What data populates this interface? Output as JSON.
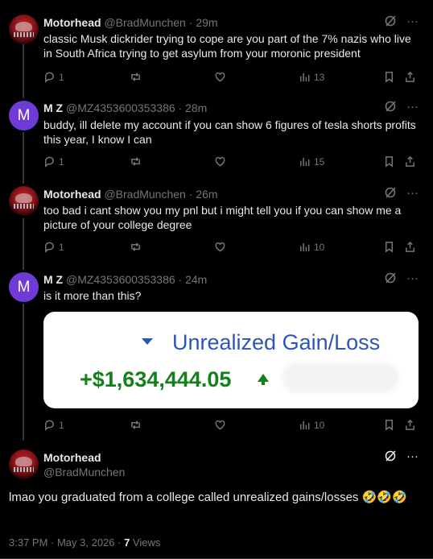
{
  "tweets": [
    {
      "name": "Motorhead",
      "handle": "@BradMunchen",
      "time": "29m",
      "text": "classic Musk dickrider trying to cope are you part of the 7% nazis who live in South Africa trying to get asylum from your moronic president",
      "replies": "1",
      "retweets": "",
      "likes": "",
      "views": "13"
    },
    {
      "name": "M Z",
      "handle": "@MZ4353600353386",
      "time": "28m",
      "text": "buddy, ill delete my account if you can show 6 figures of tesla shorts profits this year, I know I can",
      "replies": "1",
      "retweets": "",
      "likes": "",
      "views": "15"
    },
    {
      "name": "Motorhead",
      "handle": "@BradMunchen",
      "time": "26m",
      "text": "too bad i cant show you my pnl but i might tell you if you can show me a picture of your college degree",
      "replies": "1",
      "retweets": "",
      "likes": "",
      "views": "10"
    },
    {
      "name": "M Z",
      "handle": "@MZ4353600353386",
      "time": "24m",
      "text": "is it more than this?",
      "replies": "1",
      "retweets": "",
      "likes": "",
      "views": "10",
      "card": {
        "title": "Unrealized Gain/Loss",
        "gain": "+$1,634,444.05"
      }
    }
  ],
  "main": {
    "name": "Motorhead",
    "handle": "@BradMunchen",
    "text": "lmao you graduated from a college called unrealized gains/losses 🤣🤣🤣",
    "time": "3:37 PM · May 3, 2026 · ",
    "views_count": "7",
    "views_label": " Views"
  },
  "avatars": {
    "mz_letter": "M"
  },
  "sep": " · ",
  "icons": {
    "more": "···"
  }
}
